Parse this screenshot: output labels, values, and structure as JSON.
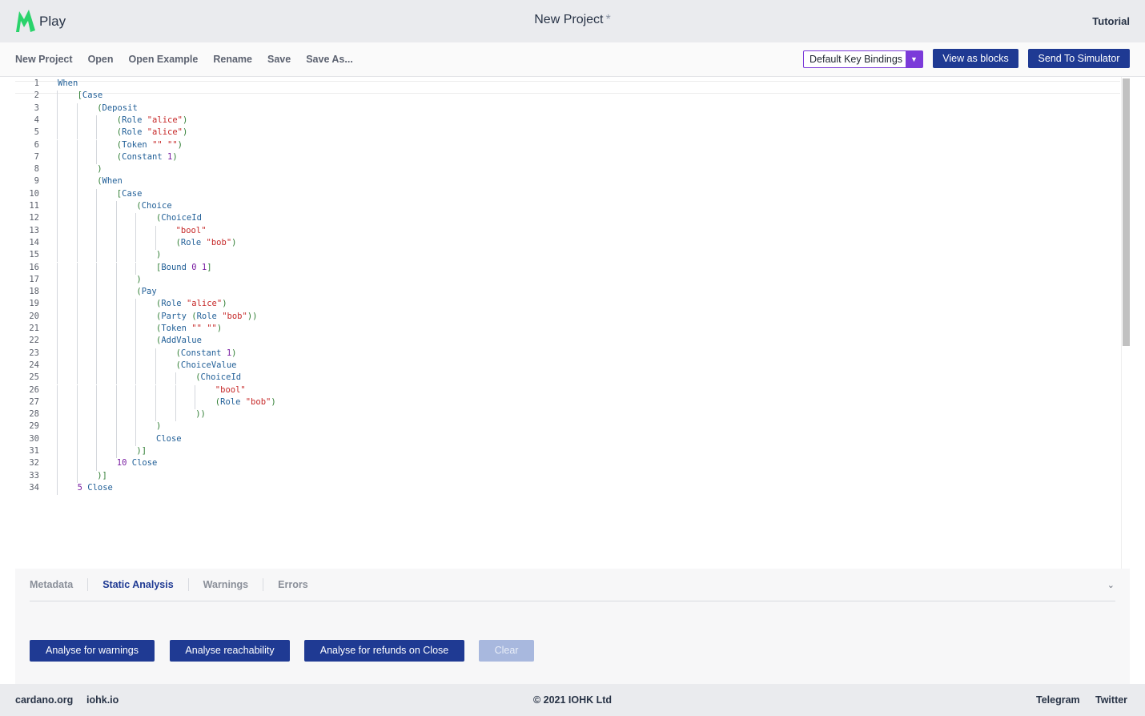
{
  "header": {
    "logo_text": "Play",
    "title": "New Project",
    "unsaved_marker": "*",
    "tutorial": "Tutorial"
  },
  "toolbar": {
    "menu": [
      "New Project",
      "Open",
      "Open Example",
      "Rename",
      "Save",
      "Save As..."
    ],
    "key_bindings": "Default Key Bindings",
    "view_as_blocks": "View as blocks",
    "send_to_simulator": "Send To Simulator"
  },
  "editor": {
    "lines": [
      [
        [
          "kw",
          "When"
        ]
      ],
      [
        [
          "p",
          "["
        ],
        [
          "kw",
          "Case"
        ]
      ],
      [
        [
          "p",
          "("
        ],
        [
          "kw",
          "Deposit"
        ]
      ],
      [
        [
          "p",
          "("
        ],
        [
          "kw",
          "Role "
        ],
        [
          "str",
          "\"alice\""
        ],
        [
          "p",
          ")"
        ]
      ],
      [
        [
          "p",
          "("
        ],
        [
          "kw",
          "Role "
        ],
        [
          "str",
          "\"alice\""
        ],
        [
          "p",
          ")"
        ]
      ],
      [
        [
          "p",
          "("
        ],
        [
          "kw",
          "Token "
        ],
        [
          "str",
          "\"\" \"\""
        ],
        [
          "p",
          ")"
        ]
      ],
      [
        [
          "p",
          "("
        ],
        [
          "kw",
          "Constant "
        ],
        [
          "num",
          "1"
        ],
        [
          "p",
          ")"
        ]
      ],
      [
        [
          "p",
          ")"
        ]
      ],
      [
        [
          "p",
          "("
        ],
        [
          "kw",
          "When"
        ]
      ],
      [
        [
          "p",
          "["
        ],
        [
          "kw",
          "Case"
        ]
      ],
      [
        [
          "p",
          "("
        ],
        [
          "kw",
          "Choice"
        ]
      ],
      [
        [
          "p",
          "("
        ],
        [
          "kw",
          "ChoiceId"
        ]
      ],
      [
        [
          "str",
          "\"bool\""
        ]
      ],
      [
        [
          "p",
          "("
        ],
        [
          "kw",
          "Role "
        ],
        [
          "str",
          "\"bob\""
        ],
        [
          "p",
          ")"
        ]
      ],
      [
        [
          "p",
          ")"
        ]
      ],
      [
        [
          "p",
          "["
        ],
        [
          "kw",
          "Bound "
        ],
        [
          "num",
          "0 1"
        ],
        [
          "p",
          "]"
        ]
      ],
      [
        [
          "p",
          ")"
        ]
      ],
      [
        [
          "p",
          "("
        ],
        [
          "kw",
          "Pay"
        ]
      ],
      [
        [
          "p",
          "("
        ],
        [
          "kw",
          "Role "
        ],
        [
          "str",
          "\"alice\""
        ],
        [
          "p",
          ")"
        ]
      ],
      [
        [
          "p",
          "("
        ],
        [
          "kw",
          "Party "
        ],
        [
          "p",
          "("
        ],
        [
          "kw",
          "Role "
        ],
        [
          "str",
          "\"bob\""
        ],
        [
          "p",
          "))"
        ]
      ],
      [
        [
          "p",
          "("
        ],
        [
          "kw",
          "Token "
        ],
        [
          "str",
          "\"\" \"\""
        ],
        [
          "p",
          ")"
        ]
      ],
      [
        [
          "p",
          "("
        ],
        [
          "kw",
          "AddValue"
        ]
      ],
      [
        [
          "p",
          "("
        ],
        [
          "kw",
          "Constant "
        ],
        [
          "num",
          "1"
        ],
        [
          "p",
          ")"
        ]
      ],
      [
        [
          "p",
          "("
        ],
        [
          "kw",
          "ChoiceValue"
        ]
      ],
      [
        [
          "p",
          "("
        ],
        [
          "kw",
          "ChoiceId"
        ]
      ],
      [
        [
          "str",
          "\"bool\""
        ]
      ],
      [
        [
          "p",
          "("
        ],
        [
          "kw",
          "Role "
        ],
        [
          "str",
          "\"bob\""
        ],
        [
          "p",
          ")"
        ]
      ],
      [
        [
          "p",
          "))"
        ]
      ],
      [
        [
          "p",
          ")"
        ]
      ],
      [
        [
          "kw",
          "Close"
        ]
      ],
      [
        [
          "p",
          ")]"
        ]
      ],
      [
        [
          "num",
          "10 "
        ],
        [
          "kw",
          "Close"
        ]
      ],
      [
        [
          "p",
          ")]"
        ]
      ],
      [
        [
          "num",
          "5 "
        ],
        [
          "kw",
          "Close"
        ]
      ]
    ]
  },
  "panel": {
    "tabs": [
      "Metadata",
      "Static Analysis",
      "Warnings",
      "Errors"
    ],
    "active_tab": "Static Analysis",
    "buttons": {
      "warnings": "Analyse for warnings",
      "reachability": "Analyse reachability",
      "refunds": "Analyse for refunds on Close",
      "clear": "Clear"
    }
  },
  "footer": {
    "left1": "cardano.org",
    "left2": "iohk.io",
    "center": "© 2021 IOHK Ltd",
    "right1": "Telegram",
    "right2": "Twitter"
  },
  "colors": {
    "primary": "#1f3a93",
    "accent": "#7b3ad9",
    "logo_green": "#1ed760"
  }
}
